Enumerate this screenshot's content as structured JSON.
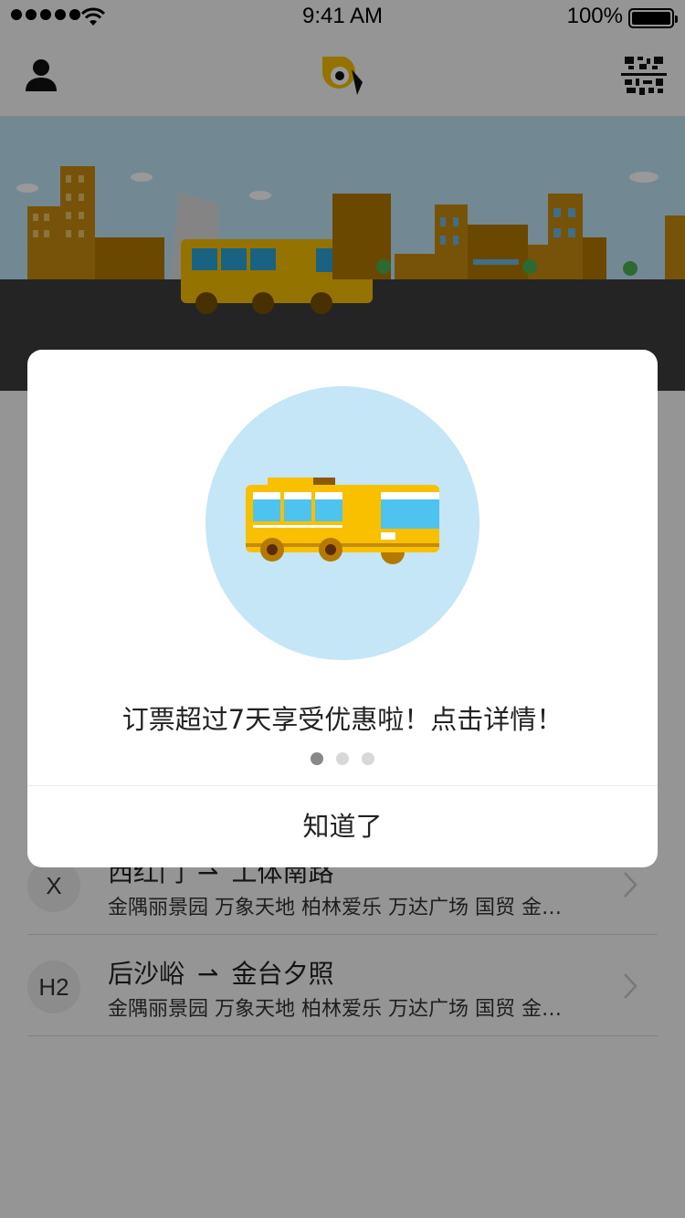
{
  "status_bar": {
    "time": "9:41 AM",
    "battery_percent": "100%",
    "signal_icon": "signal-dots-icon",
    "wifi_icon": "wifi-icon",
    "battery_icon": "battery-icon"
  },
  "nav": {
    "left_icon": "user-icon",
    "center_logo": "app-logo-icon",
    "right_icon": "qr-code-icon"
  },
  "colors": {
    "brand_yellow": "#f9c000",
    "dialog_circle": "#c5e6f7",
    "overlay": "rgba(0,0,0,0.4)"
  },
  "routes": [
    {
      "badge": "X",
      "from": "西红门",
      "to": "工体南路",
      "stops": "金隅丽景园 万象天地 柏林爱乐 万达广场 国贸 金…"
    },
    {
      "badge": "H2",
      "from": "后沙峪",
      "to": "金台夕照",
      "stops": "金隅丽景园 万象天地 柏林爱乐 万达广场 国贸 金…"
    }
  ],
  "route_arrow": "⇀",
  "dialog": {
    "message": "订票超过7天享受优惠啦！点击详情！",
    "page_indicator": {
      "total": 3,
      "active": 1
    },
    "button_label": "知道了"
  }
}
